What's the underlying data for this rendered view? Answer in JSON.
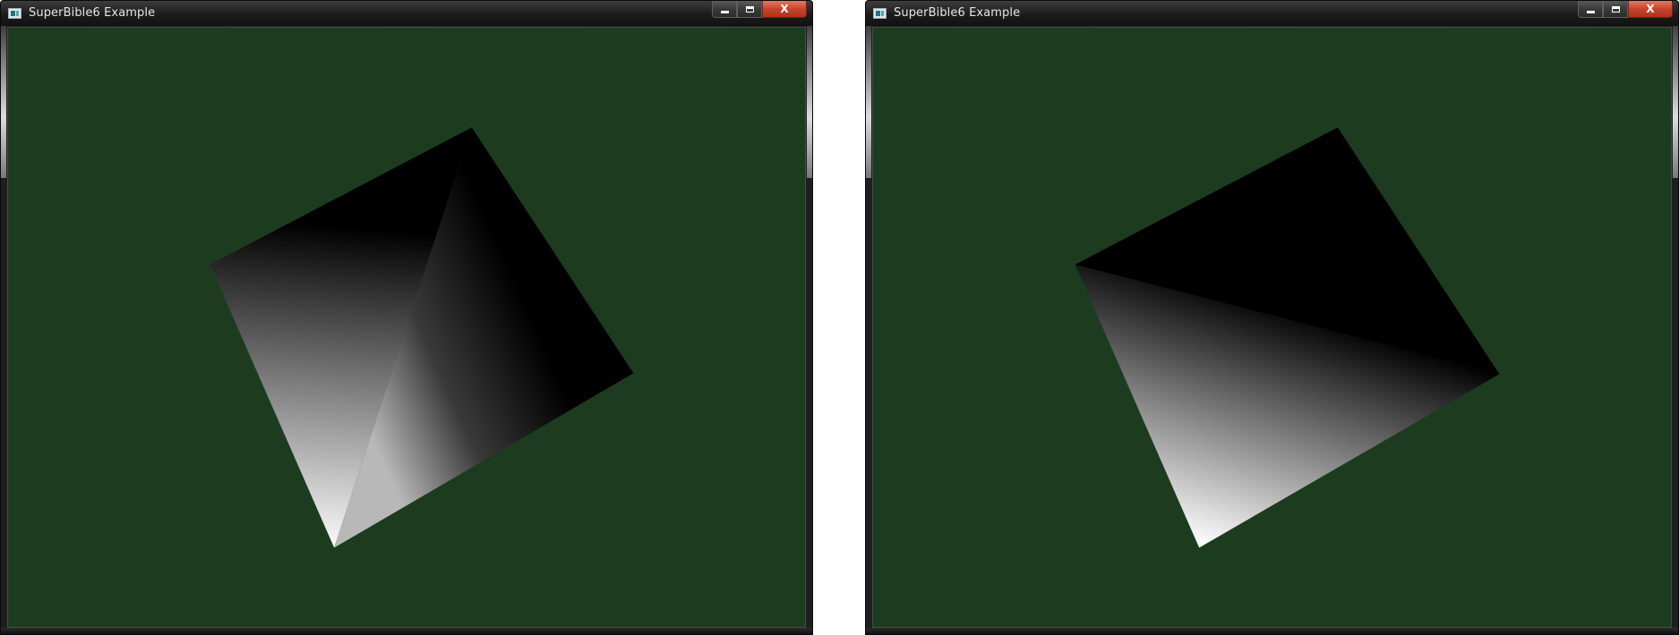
{
  "windows": [
    {
      "id": "left",
      "title": "SuperBible6 Example",
      "buttons": {
        "minimize": "minimize",
        "maximize": "maximize",
        "close": "X"
      },
      "icons": {
        "app": "app-window-icon",
        "minimize": "minimize-icon",
        "maximize": "maximize-icon",
        "close": "close-icon"
      },
      "clear_color": "#1d3c1f",
      "shading": "per-vertex gradient"
    },
    {
      "id": "right",
      "title": "SuperBible6 Example",
      "buttons": {
        "minimize": "minimize",
        "maximize": "maximize",
        "close": "X"
      },
      "icons": {
        "app": "app-window-icon",
        "minimize": "minimize-icon",
        "maximize": "maximize-icon",
        "close": "close-icon"
      },
      "clear_color": "#1d3c1f",
      "shading": "flat-corner gradient"
    }
  ],
  "colors": {
    "titlebar": "#1b1b1b",
    "close_button": "#c7442b",
    "quad_light": "#ffffff",
    "quad_dark": "#000000"
  }
}
